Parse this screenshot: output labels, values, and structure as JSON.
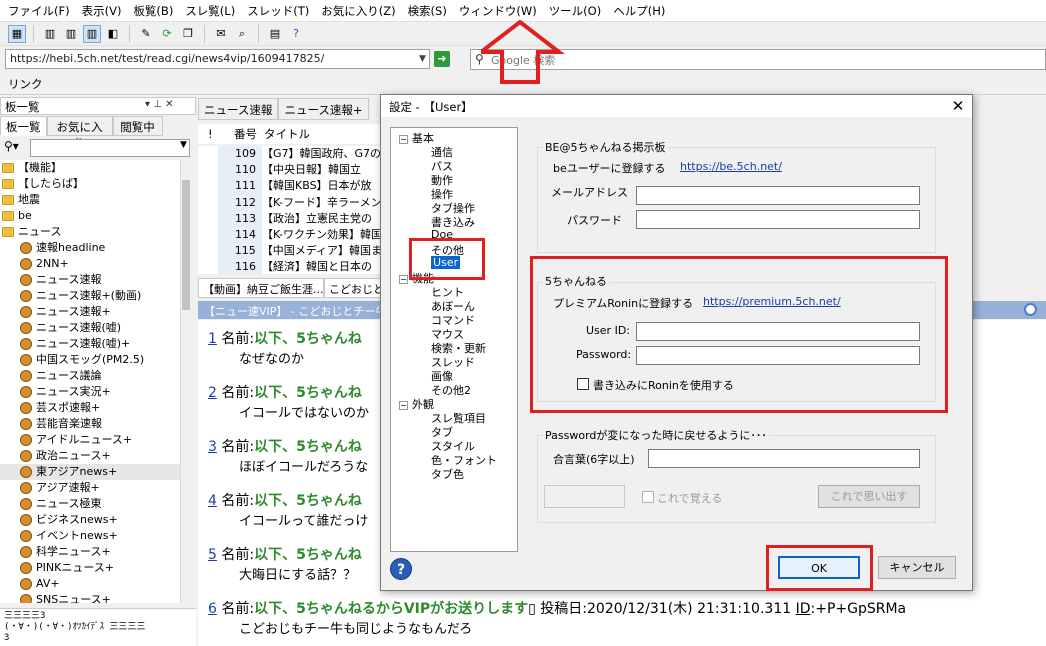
{
  "menu": [
    "ファイル(F)",
    "表示(V)",
    "板覧(B)",
    "スレ覧(L)",
    "スレッド(T)",
    "お気に入り(Z)",
    "検索(S)",
    "ウィンドウ(W)",
    "ツール(O)",
    "ヘルプ(H)"
  ],
  "address": {
    "url": "https://hebi.5ch.net/test/read.cgi/news4vip/1609417825/",
    "go_icon": "arrow-right-icon"
  },
  "search": {
    "placeholder": "Google 検索"
  },
  "link_bar": "リンク",
  "left_pane": {
    "title": "板一覧",
    "tabs": [
      "板一覧",
      "お気に入り",
      "閲覧中"
    ],
    "tree": [
      {
        "label": "【機能】",
        "kind": "folder"
      },
      {
        "label": "【したらば】",
        "kind": "folder"
      },
      {
        "label": "地震",
        "kind": "folder"
      },
      {
        "label": "be",
        "kind": "folder"
      },
      {
        "label": "ニュース",
        "kind": "folder"
      },
      {
        "label": "速報headline",
        "kind": "board"
      },
      {
        "label": "2NN+",
        "kind": "board"
      },
      {
        "label": "ニュース速報",
        "kind": "board"
      },
      {
        "label": "ニュース速報+(動画)",
        "kind": "board"
      },
      {
        "label": "ニュース速報+",
        "kind": "board"
      },
      {
        "label": "ニュース速報(嘘)",
        "kind": "board"
      },
      {
        "label": "ニュース速報(嘘)+",
        "kind": "board"
      },
      {
        "label": "中国スモッグ(PM2.5)",
        "kind": "board"
      },
      {
        "label": "ニュース議論",
        "kind": "board"
      },
      {
        "label": "ニュース実況+",
        "kind": "board"
      },
      {
        "label": "芸スポ速報+",
        "kind": "board"
      },
      {
        "label": "芸能音楽速報",
        "kind": "board"
      },
      {
        "label": "アイドルニュース+",
        "kind": "board"
      },
      {
        "label": "政治ニュース+",
        "kind": "board"
      },
      {
        "label": "東アジアnews+",
        "kind": "board",
        "selected": true
      },
      {
        "label": "アジア速報+",
        "kind": "board"
      },
      {
        "label": "ニュース極東",
        "kind": "board"
      },
      {
        "label": "ビジネスnews+",
        "kind": "board"
      },
      {
        "label": "イベントnews+",
        "kind": "board"
      },
      {
        "label": "科学ニュース+",
        "kind": "board"
      },
      {
        "label": "PINKニュース+",
        "kind": "board"
      },
      {
        "label": "AV+",
        "kind": "board"
      },
      {
        "label": "SNSニュース+",
        "kind": "board"
      }
    ],
    "ascii_art": "三三三三3\n(・∀・)(・∀・)ｵﾂｶｲﾃﾞｽ 三三三三\n3"
  },
  "thread_list": {
    "tabs": [
      "ニュース速報",
      "ニュース速報+"
    ],
    "columns": {
      "mark": "!",
      "number": "番号",
      "title": "タイトル"
    },
    "rows": [
      {
        "number": "109",
        "title": "【G7】韓国政府、G7の"
      },
      {
        "number": "110",
        "title": "【中央日報】韓国立"
      },
      {
        "number": "111",
        "title": "【韓国KBS】日本が放"
      },
      {
        "number": "112",
        "title": "【K-フード】辛ラーメン"
      },
      {
        "number": "113",
        "title": "【政治】立憲民主党の"
      },
      {
        "number": "114",
        "title": "【K-ワクチン効果】韓国"
      },
      {
        "number": "115",
        "title": "【中国メディア】韓国ま"
      },
      {
        "number": "116",
        "title": "【経済】韓国と日本の"
      }
    ]
  },
  "viewer": {
    "tabs": [
      "【動画】納豆ご飯生涯...",
      "こどおじと"
    ],
    "title_bar": "【ニュー速VIP】 - こどおじとチー牛なら",
    "posts": [
      {
        "no": "1",
        "label": "名前:",
        "name": "以下、5ちゃんね",
        "body": "なぜなのか"
      },
      {
        "no": "2",
        "label": "名前:",
        "name": "以下、5ちゃんね",
        "body": "イコールではないのか"
      },
      {
        "no": "3",
        "label": "名前:",
        "name": "以下、5ちゃんね",
        "body": "ほぼイコールだろうな"
      },
      {
        "no": "4",
        "label": "名前:",
        "name": "以下、5ちゃんね",
        "body": "イコールって誰だっけ"
      },
      {
        "no": "5",
        "label": "名前:",
        "name": "以下、5ちゃんね",
        "body": "大晦日にする話？？"
      },
      {
        "no": "6",
        "label": "名前:",
        "name": "以下、5ちゃんねるからVIPがお送りします",
        "meta": "投稿日:2020/12/31(木) 21:31:10.311 ",
        "id_label": "ID",
        "id_value": ":+P+GpSRMa",
        "body": "こどおじもチー牛も同じようなもんだろ"
      }
    ]
  },
  "dialog": {
    "title": "設定 - 【User】",
    "tree": {
      "groups": [
        {
          "label": "基本",
          "items": [
            "通信",
            "パス",
            "動作",
            "操作",
            "タブ操作",
            "書き込み",
            "Doe",
            "その他",
            "User"
          ]
        },
        {
          "label": "機能",
          "items": [
            "ヒント",
            "あぼーん",
            "コマンド",
            "マウス",
            "検索・更新",
            "スレッド",
            "画像",
            "その他2"
          ]
        },
        {
          "label": "外観",
          "items": [
            "スレ覧項目",
            "タブ",
            "スタイル",
            "色・フォント",
            "タブ色"
          ]
        }
      ],
      "selected": "User"
    },
    "be": {
      "group": "BE@5ちゃんねる掲示板",
      "register_label": "beユーザーに登録する",
      "register_link": "https://be.5ch.net/",
      "mail_label": "メールアドレス",
      "password_label": "パスワード",
      "mail_value": "",
      "password_value": ""
    },
    "ronin": {
      "group": "5ちゃんねる",
      "register_label": "プレミアムRoninに登録する",
      "register_link": "https://premium.5ch.net/",
      "userid_label": "User ID:",
      "password_label": "Password:",
      "userid_value": "",
      "password_value": "",
      "use_ronin_label": "書き込みにRoninを使用する",
      "use_ronin_checked": false
    },
    "recovery": {
      "group": "Passwordが変になった時に戻せるように･･･",
      "passphrase_label": "合言葉(6字以上)",
      "passphrase_value": "",
      "remember_label": "これで覚える",
      "recall_button": "これで思い出す"
    },
    "ok": "OK",
    "cancel": "キャンセル"
  },
  "colors": {
    "highlight": "#e02020",
    "selection": "#0a64d2",
    "post_name": "#2d8a2d",
    "link": "#1a3fa8",
    "title_bar": "#97b1d9"
  }
}
